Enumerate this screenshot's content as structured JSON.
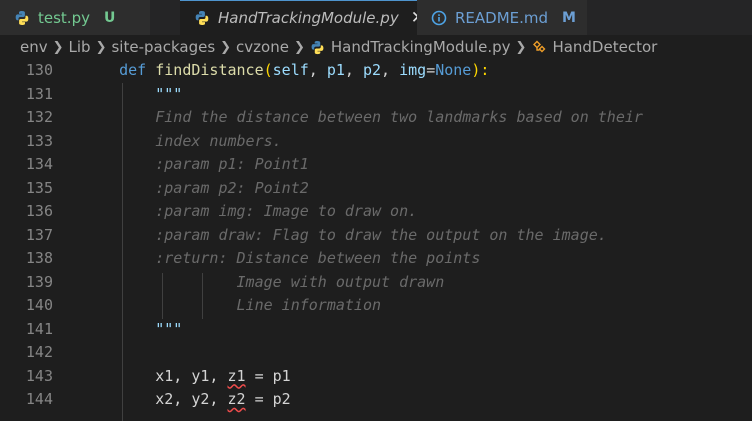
{
  "tabs": [
    {
      "label": "test.py",
      "status": "U",
      "style": "green",
      "active": false
    },
    {
      "label": "HandTrackingModule.py",
      "close": "✕",
      "style": "italic",
      "active": true
    },
    {
      "label": "README.md",
      "status": "M",
      "style": "blue",
      "active": false
    }
  ],
  "breadcrumb": [
    "env",
    "Lib",
    "site-packages",
    "cvzone",
    "HandTrackingModule.py",
    "HandDetector"
  ],
  "lines": [
    {
      "n": "130",
      "tokens": [
        [
          "    ",
          "tok-plain"
        ],
        [
          "def ",
          "tok-kw"
        ],
        [
          "findDistance",
          "tok-fn"
        ],
        [
          "(",
          "tok-paren"
        ],
        [
          "self",
          "tok-self"
        ],
        [
          ", ",
          "tok-plain"
        ],
        [
          "p1",
          "tok-param"
        ],
        [
          ", ",
          "tok-plain"
        ],
        [
          "p2",
          "tok-param"
        ],
        [
          ", ",
          "tok-plain"
        ],
        [
          "img",
          "tok-param"
        ],
        [
          "=",
          "tok-plain"
        ],
        [
          "None",
          "tok-const"
        ],
        [
          "):",
          "tok-paren"
        ]
      ]
    },
    {
      "n": "131",
      "tokens": [
        [
          "        ",
          "tok-plain"
        ],
        [
          "\"\"\"",
          "docq"
        ]
      ]
    },
    {
      "n": "132",
      "tokens": [
        [
          "        ",
          "tok-plain"
        ],
        [
          "Find the distance between two landmarks based on their",
          "doc"
        ]
      ]
    },
    {
      "n": "133",
      "tokens": [
        [
          "        ",
          "tok-plain"
        ],
        [
          "index numbers.",
          "doc"
        ]
      ]
    },
    {
      "n": "134",
      "tokens": [
        [
          "        ",
          "tok-plain"
        ],
        [
          ":param p1: Point1",
          "doc"
        ]
      ]
    },
    {
      "n": "135",
      "tokens": [
        [
          "        ",
          "tok-plain"
        ],
        [
          ":param p2: Point2",
          "doc"
        ]
      ]
    },
    {
      "n": "136",
      "tokens": [
        [
          "        ",
          "tok-plain"
        ],
        [
          ":param img: Image to draw on.",
          "doc"
        ]
      ]
    },
    {
      "n": "137",
      "tokens": [
        [
          "        ",
          "tok-plain"
        ],
        [
          ":param draw: Flag to draw the output on the image.",
          "doc"
        ]
      ]
    },
    {
      "n": "138",
      "tokens": [
        [
          "        ",
          "tok-plain"
        ],
        [
          ":return: Distance between the points",
          "doc"
        ]
      ]
    },
    {
      "n": "139",
      "tokens": [
        [
          "                 ",
          "tok-plain"
        ],
        [
          "Image with output drawn",
          "doc"
        ]
      ]
    },
    {
      "n": "140",
      "tokens": [
        [
          "                 ",
          "tok-plain"
        ],
        [
          "Line information",
          "doc"
        ]
      ]
    },
    {
      "n": "141",
      "tokens": [
        [
          "        ",
          "tok-plain"
        ],
        [
          "\"\"\"",
          "docq"
        ]
      ]
    },
    {
      "n": "142",
      "tokens": []
    },
    {
      "n": "143",
      "tokens": [
        [
          "        ",
          "tok-plain"
        ],
        [
          "x1, y1, ",
          "tok-plain"
        ],
        [
          "z1",
          "tok-plain err"
        ],
        [
          " = p1",
          "tok-plain"
        ]
      ]
    },
    {
      "n": "144",
      "tokens": [
        [
          "        ",
          "tok-plain"
        ],
        [
          "x2, y2, ",
          "tok-plain"
        ],
        [
          "z2",
          "tok-plain err"
        ],
        [
          " = p2",
          "tok-plain"
        ]
      ]
    }
  ]
}
